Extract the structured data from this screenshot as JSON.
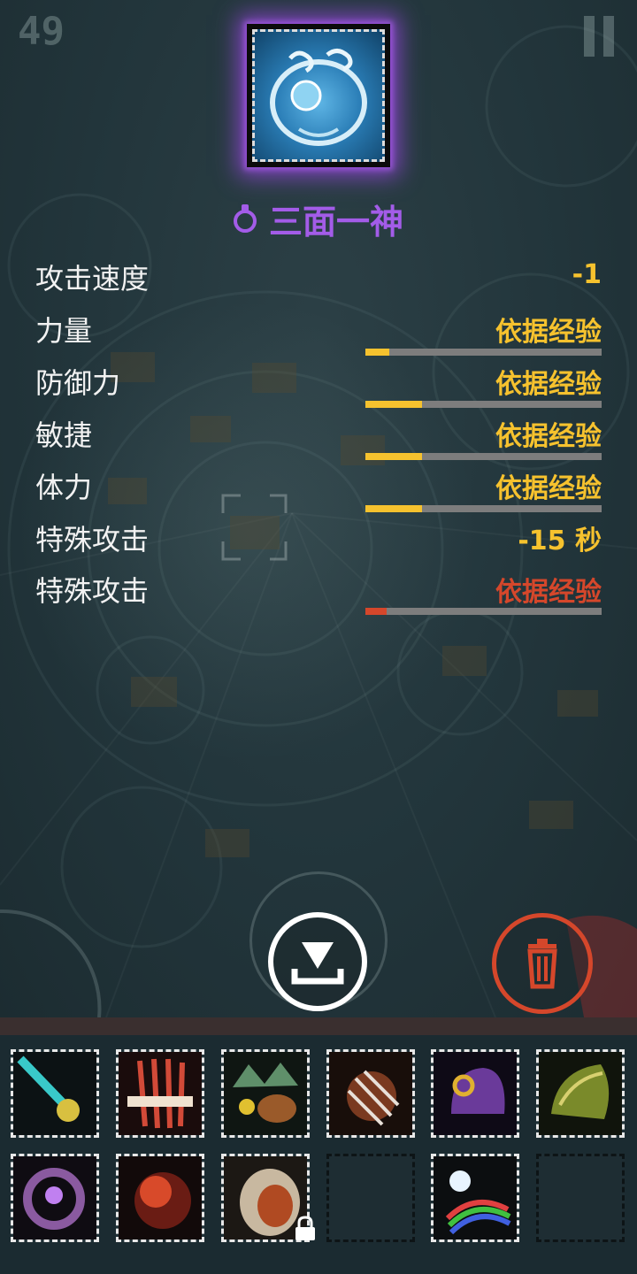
{
  "hud": {
    "counter": "49"
  },
  "item": {
    "name": "三面一神",
    "rarity_color": "#a35ce8",
    "icon": "blue-ring-amulet-icon"
  },
  "stats": [
    {
      "label": "攻击速度",
      "value": "-1",
      "has_bar": false,
      "color": "#f6c22e"
    },
    {
      "label": "力量",
      "value": "依据经验",
      "has_bar": true,
      "fill": 0.1,
      "color": "#f6c22e"
    },
    {
      "label": "防御力",
      "value": "依据经验",
      "has_bar": true,
      "fill": 0.24,
      "color": "#f6c22e"
    },
    {
      "label": "敏捷",
      "value": "依据经验",
      "has_bar": true,
      "fill": 0.24,
      "color": "#f6c22e"
    },
    {
      "label": "体力",
      "value": "依据经验",
      "has_bar": true,
      "fill": 0.24,
      "color": "#f6c22e"
    },
    {
      "label": "特殊攻击",
      "value": "-15 秒",
      "has_bar": false,
      "color": "#f6c22e"
    },
    {
      "label": "特殊攻击",
      "value": "依据经验",
      "has_bar": true,
      "fill": 0.09,
      "color": "#d5472b"
    }
  ],
  "actions": {
    "drop_icon": "drop-down-icon",
    "trash_icon": "trash-icon"
  },
  "inventory": [
    {
      "icon": "cyan-dagger-icon",
      "empty": false,
      "locked": false
    },
    {
      "icon": "red-claw-icon",
      "empty": false,
      "locked": false
    },
    {
      "icon": "green-gem-crown-icon",
      "empty": false,
      "locked": false
    },
    {
      "icon": "spiked-gauntlet-icon",
      "empty": false,
      "locked": false
    },
    {
      "icon": "purple-helm-icon",
      "empty": false,
      "locked": false
    },
    {
      "icon": "green-feather-helm-icon",
      "empty": false,
      "locked": false
    },
    {
      "icon": "purple-eye-ring-icon",
      "empty": false,
      "locked": false
    },
    {
      "icon": "red-orb-ring-icon",
      "empty": false,
      "locked": false
    },
    {
      "icon": "orange-bracer-icon",
      "empty": false,
      "locked": true
    },
    {
      "icon": "",
      "empty": true,
      "locked": false
    },
    {
      "icon": "rainbow-jewel-icon",
      "empty": false,
      "locked": false
    },
    {
      "icon": "",
      "empty": true,
      "locked": false
    }
  ]
}
